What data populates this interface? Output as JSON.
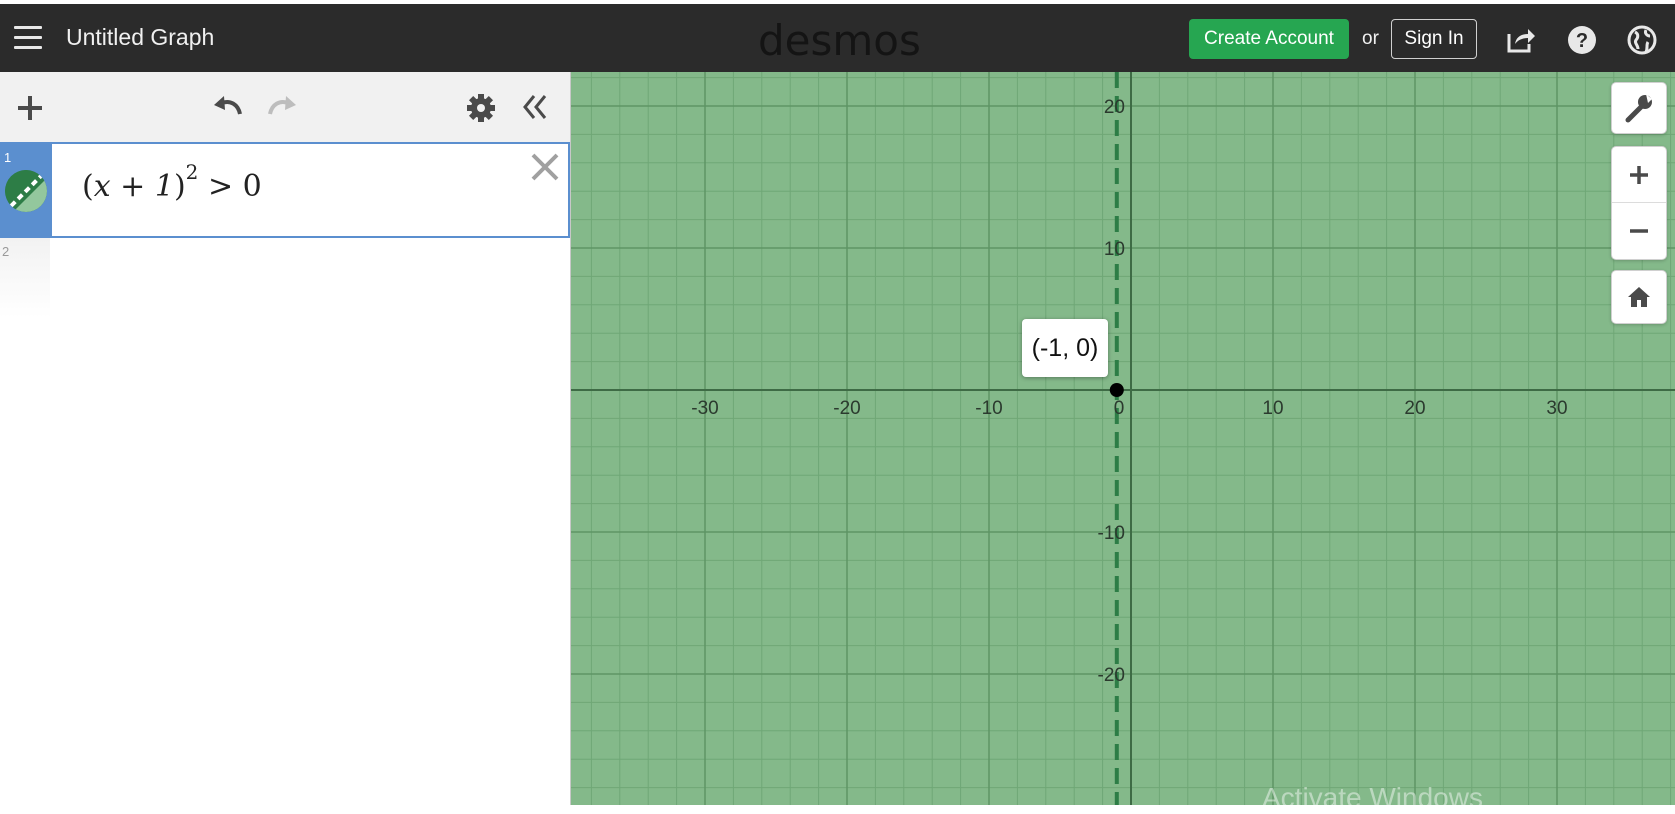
{
  "header": {
    "title": "Untitled Graph",
    "brand": "desmos",
    "create_account": "Create Account",
    "or": "or",
    "sign_in": "Sign In"
  },
  "expressions": [
    {
      "index": "1",
      "latex": "(x+1)^2 > 0",
      "base": "x + 1",
      "exponent": "2",
      "rest": "> 0",
      "color": "#2d7d46",
      "style": "dashed"
    },
    {
      "index": "2",
      "latex": ""
    }
  ],
  "graph": {
    "background": "#84b98a",
    "x_ticks": [
      "-30",
      "-20",
      "-10",
      "0",
      "10",
      "20",
      "30"
    ],
    "y_ticks": [
      "20",
      "10",
      "-10",
      "-20"
    ],
    "point_label": "(-1, 0)",
    "point": {
      "x": -1,
      "y": 0
    },
    "boundary_line_x": -1
  },
  "overlay": {
    "watermark": "Activate Windows"
  },
  "colors": {
    "topbar": "#2b2b2b",
    "accent_green": "#26a651",
    "selection_blue": "#5b8fcf"
  },
  "icons": [
    "menu-icon",
    "share-icon",
    "help-icon",
    "globe-icon",
    "plus-icon",
    "undo-icon",
    "redo-icon",
    "gear-icon",
    "collapse-icon",
    "close-icon",
    "wrench-icon",
    "zoom-in-icon",
    "zoom-out-icon",
    "home-icon"
  ]
}
